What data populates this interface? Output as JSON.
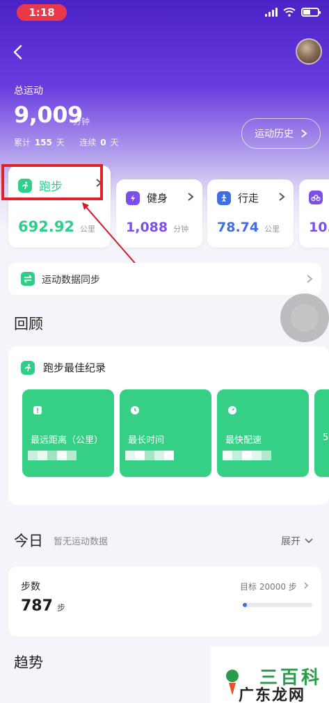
{
  "status_bar": {
    "time": "1:18"
  },
  "header": {
    "total_label": "总运动",
    "total_value": "9,009",
    "total_unit": "分钟",
    "cumulative_label": "累计",
    "cumulative_value": "155",
    "cumulative_unit": "天",
    "streak_label": "连续",
    "streak_value": "0",
    "streak_unit": "天",
    "history_button": "运动历史"
  },
  "sports": [
    {
      "label": "跑步",
      "value": "692.92",
      "unit": "公里",
      "color": "#2fce8a",
      "icon": "running-icon"
    },
    {
      "label": "健身",
      "value": "1,088",
      "unit": "分钟",
      "color": "#7b4fe8",
      "icon": "lightning-icon"
    },
    {
      "label": "行走",
      "value": "78.74",
      "unit": "公里",
      "color": "#3f6de3",
      "icon": "walking-icon"
    },
    {
      "label": "",
      "value": "10.",
      "unit": "",
      "color": "#7b4fe8",
      "icon": "cycling-icon"
    }
  ],
  "sync": {
    "label": "运动数据同步"
  },
  "review": {
    "title": "回顾",
    "card_title": "跑步最佳纪录",
    "tiles": [
      {
        "label": "最远距离（公里）",
        "icon": "alert-icon"
      },
      {
        "label": "最长时间",
        "icon": "timer-icon"
      },
      {
        "label": "最快配速",
        "icon": "speedometer-icon"
      },
      {
        "label": "5",
        "icon": ""
      }
    ]
  },
  "today": {
    "title": "今日",
    "subtitle": "暂无运动数据",
    "expand": "展开",
    "steps_label": "步数",
    "steps_value": "787",
    "steps_unit": "步",
    "goal_text": "目标 20000 步",
    "progress": 0.04
  },
  "trend": {
    "title": "趋势"
  },
  "watermark": {
    "top": "三百科",
    "bottom": "广东龙网"
  },
  "colors": {
    "accent_green": "#35cf86",
    "header_purple": "#4a22c6",
    "annotation_red": "#e2222b"
  }
}
